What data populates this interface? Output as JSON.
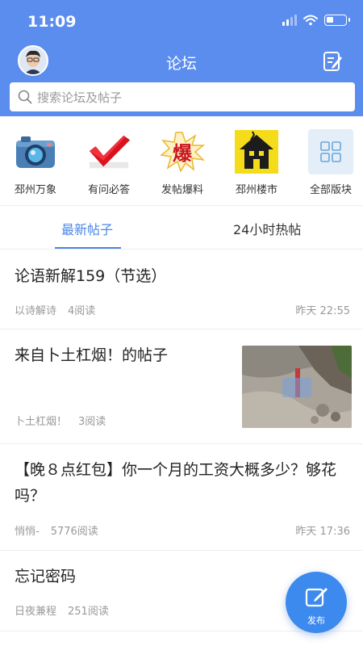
{
  "status": {
    "time": "11:09"
  },
  "header": {
    "title": "论坛"
  },
  "search": {
    "placeholder": "搜索论坛及帖子"
  },
  "categories": [
    {
      "label": "邳州万象",
      "icon": "camera-icon"
    },
    {
      "label": "有问必答",
      "icon": "checkmark-icon"
    },
    {
      "label": "发帖爆料",
      "icon": "explosion-icon"
    },
    {
      "label": "邳州楼市",
      "icon": "house-icon"
    },
    {
      "label": "全部版块",
      "icon": "grid-icon"
    }
  ],
  "tabs": {
    "latest": "最新帖子",
    "hot": "24小时热帖"
  },
  "posts": [
    {
      "title": "论语新解159（节选）",
      "author": "以诗解诗",
      "reads": "4阅读",
      "time": "昨天 22:55"
    },
    {
      "title": "来自卜土杠烟！的帖子",
      "author": "卜土杠烟！",
      "reads": "3阅读",
      "time": ""
    },
    {
      "title": "【晚８点红包】你一个月的工资大概多少？够花吗？",
      "author": "悄悄-",
      "reads": "5776阅读",
      "time": "昨天 17:36"
    },
    {
      "title": "忘记密码",
      "author": "日夜兼程",
      "reads": "251阅读",
      "time": ""
    }
  ],
  "fab": {
    "label": "发布"
  },
  "colors": {
    "primary": "#5B8DEF",
    "accent": "#4A87E6",
    "fab": "#3C8AEE"
  }
}
